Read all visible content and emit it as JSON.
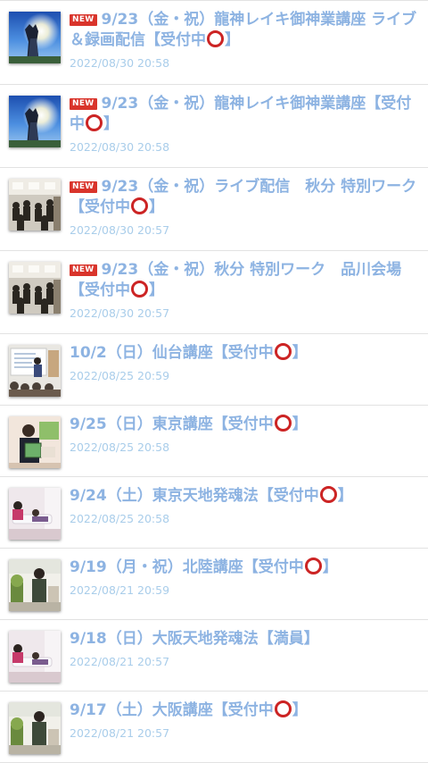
{
  "colors": {
    "title": "#8db3e2",
    "date": "#a9cdea",
    "new_badge_bg": "#d9342b",
    "circle_mark": "#cc2424",
    "divider": "#e2e2e2"
  },
  "badge": {
    "new_label": "NEW"
  },
  "posts": [
    {
      "thumbnail": "dragon-shrine-photo",
      "is_new": true,
      "title_prefix": "9/23（金・祝）龍神レイキ御神業講座 ライブ＆録画配信【受付中",
      "has_circle": true,
      "title_suffix": "】",
      "date": "2022/08/30 20:58"
    },
    {
      "thumbnail": "dragon-shrine-photo",
      "is_new": true,
      "title_prefix": "9/23（金・祝）龍神レイキ御神業講座【受付中",
      "has_circle": true,
      "title_suffix": "】",
      "date": "2022/08/30 20:58"
    },
    {
      "thumbnail": "workshop-hall-photo",
      "is_new": true,
      "title_prefix": "9/23（金・祝）ライブ配信　秋分 特別ワーク【受付中",
      "has_circle": true,
      "title_suffix": "】",
      "date": "2022/08/30 20:57"
    },
    {
      "thumbnail": "workshop-hall-photo",
      "is_new": true,
      "title_prefix": "9/23（金・祝）秋分 特別ワーク　品川会場【受付中",
      "has_circle": true,
      "title_suffix": "】",
      "date": "2022/08/30 20:57"
    },
    {
      "thumbnail": "lecture-whiteboard-photo",
      "is_new": false,
      "title_prefix": "10/2（日）仙台講座【受付中",
      "has_circle": true,
      "title_suffix": "】",
      "date": "2022/08/25 20:59"
    },
    {
      "thumbnail": "speaker-book-photo",
      "is_new": false,
      "title_prefix": "9/25（日）東京講座【受付中",
      "has_circle": true,
      "title_suffix": "】",
      "date": "2022/08/25 20:58"
    },
    {
      "thumbnail": "healing-session-photo",
      "is_new": false,
      "title_prefix": "9/24（土）東京天地発魂法【受付中",
      "has_circle": true,
      "title_suffix": "】",
      "date": "2022/08/25 20:58"
    },
    {
      "thumbnail": "speaker-room-photo",
      "is_new": false,
      "title_prefix": "9/19（月・祝）北陸講座【受付中",
      "has_circle": true,
      "title_suffix": "】",
      "date": "2022/08/21 20:59"
    },
    {
      "thumbnail": "healing-session-photo",
      "is_new": false,
      "title_prefix": "9/18（日）大阪天地発魂法【満員】",
      "has_circle": false,
      "title_suffix": "",
      "date": "2022/08/21 20:57"
    },
    {
      "thumbnail": "speaker-room-photo",
      "is_new": false,
      "title_prefix": "9/17（土）大阪講座【受付中",
      "has_circle": true,
      "title_suffix": "】",
      "date": "2022/08/21 20:57"
    }
  ]
}
